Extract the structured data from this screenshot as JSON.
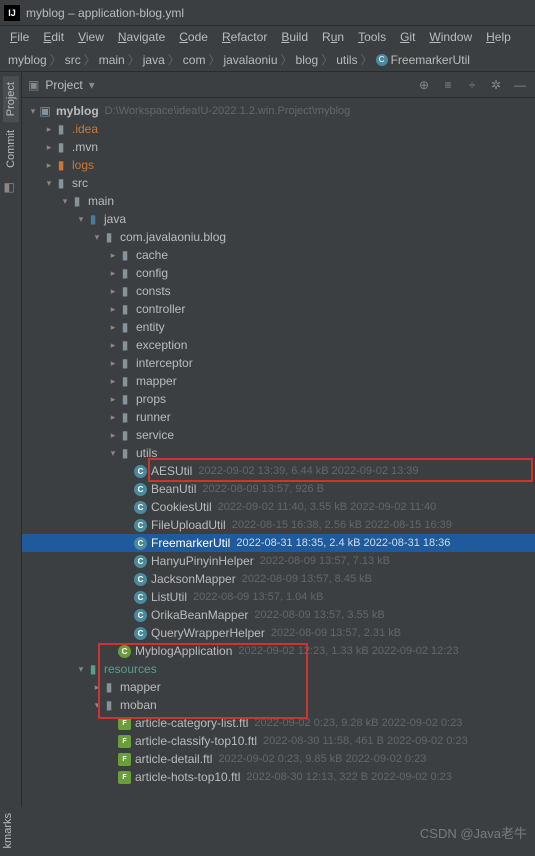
{
  "title_bar": {
    "app_icon": "IJ",
    "text": "myblog – application-blog.yml"
  },
  "menu": {
    "file": "File",
    "edit": "Edit",
    "view": "View",
    "navigate": "Navigate",
    "code": "Code",
    "refactor": "Refactor",
    "build": "Build",
    "run": "Run",
    "tools": "Tools",
    "git": "Git",
    "window": "Window",
    "help": "Help"
  },
  "breadcrumb": {
    "items": [
      "myblog",
      "src",
      "main",
      "java",
      "com",
      "javalaoniu",
      "blog",
      "utils"
    ],
    "last": "FreemarkerUtil"
  },
  "panel": {
    "title": "Project"
  },
  "rail": {
    "project": "Project",
    "commit": "Commit",
    "bookmarks": "kmarks"
  },
  "root": {
    "name": "myblog",
    "path": "D:\\Workspace\\ideaIU-2022.1.2.win.Project\\myblog"
  },
  "nodes": {
    "idea": ".idea",
    "mvn": ".mvn",
    "logs": "logs",
    "src": "src",
    "main": "main",
    "java": "java",
    "pkg": "com.javalaoniu.blog",
    "cache": "cache",
    "config": "config",
    "consts": "consts",
    "controller": "controller",
    "entity": "entity",
    "exception": "exception",
    "interceptor": "interceptor",
    "mapper": "mapper",
    "props": "props",
    "runner": "runner",
    "service": "service",
    "utils": "utils",
    "aes": "AESUtil",
    "aes_meta": "2022-09-02 13:39, 6.44 kB 2022-09-02 13:39",
    "bean": "BeanUtil",
    "bean_meta": "2022-08-09 13:57, 926 B",
    "cookies": "CookiesUtil",
    "cookies_meta": "2022-09-02 11:40, 3.55 kB 2022-09-02 11:40",
    "fileupload": "FileUploadUtil",
    "fileupload_meta": "2022-08-15 16:38, 2.56 kB 2022-08-15 16:39",
    "freemarker": "FreemarkerUtil",
    "freemarker_meta": "2022-08-31 18:35, 2.4 kB 2022-08-31 18:36",
    "hanyu": "HanyuPinyinHelper",
    "hanyu_meta": "2022-08-09 13:57, 7.13 kB",
    "jackson": "JacksonMapper",
    "jackson_meta": "2022-08-09 13:57, 8.45 kB",
    "listutil": "ListUtil",
    "listutil_meta": "2022-08-09 13:57, 1.04 kB",
    "orika": "OrikaBeanMapper",
    "orika_meta": "2022-08-09 13:57, 3.55 kB",
    "query": "QueryWrapperHelper",
    "query_meta": "2022-08-09 13:57, 2.31 kB",
    "myblogapp": "MyblogApplication",
    "myblogapp_meta": "2022-09-02 12:23, 1.33 kB 2022-09-02 12:23",
    "resources": "resources",
    "mapper2": "mapper",
    "moban": "moban",
    "ftl1": "article-category-list.ftl",
    "ftl1_meta": "2022-09-02 0:23, 9.28 kB 2022-09-02 0:23",
    "ftl2": "article-classify-top10.ftl",
    "ftl2_meta": "2022-08-30 11:58, 461 B 2022-09-02 0:23",
    "ftl3": "article-detail.ftl",
    "ftl3_meta": "2022-09-02 0:23, 9.85 kB 2022-09-02 0:23",
    "ftl4": "article-hots-top10.ftl",
    "ftl4_meta": "2022-08-30 12:13, 322 B 2022-09-02 0:23"
  },
  "watermark": "CSDN @Java老牛"
}
